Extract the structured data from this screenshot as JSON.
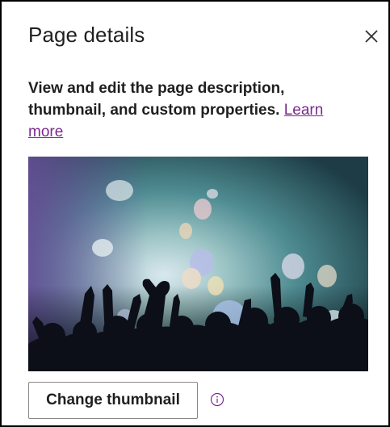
{
  "panel": {
    "title": "Page details",
    "close_icon": "close-icon",
    "description": "View and edit the page description, thumbnail, and custom properties.",
    "learn_more_label": "Learn more",
    "thumbnail_alt": "Concert crowd with balloons and hands forming a heart",
    "change_thumbnail_label": "Change thumbnail",
    "info_icon": "info-icon"
  },
  "colors": {
    "link": "#7b2a8f",
    "text": "#1f1f1f",
    "button_border": "#8a8886",
    "info_icon": "#7b2a8f"
  }
}
